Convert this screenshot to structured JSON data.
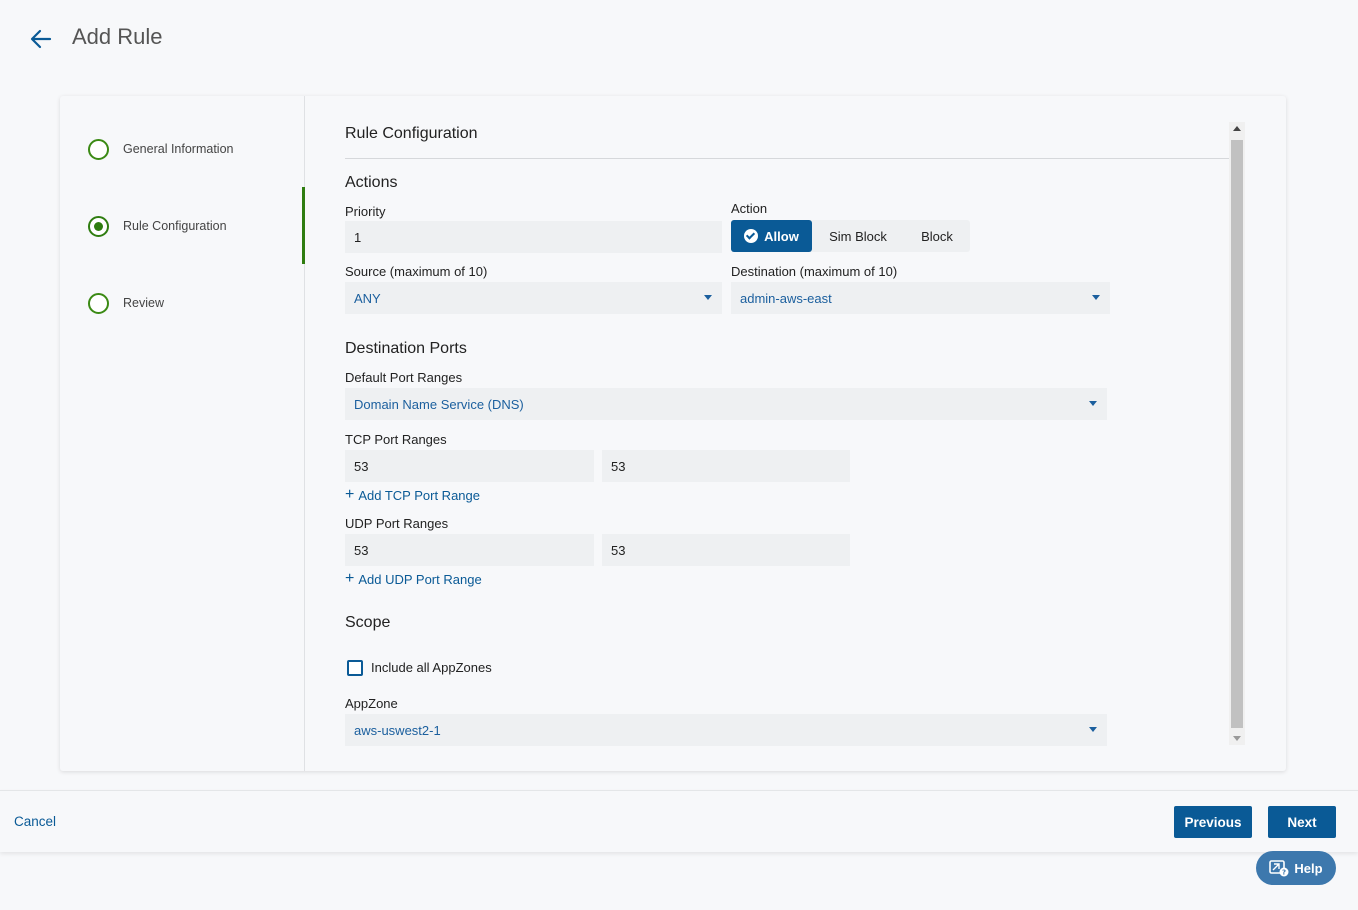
{
  "header": {
    "title": "Add Rule"
  },
  "steps": [
    {
      "label": "General Information",
      "state": "done"
    },
    {
      "label": "Rule Configuration",
      "state": "active"
    },
    {
      "label": "Review",
      "state": "pending"
    }
  ],
  "form": {
    "section_title": "Rule Configuration",
    "actions": {
      "title": "Actions",
      "priority_label": "Priority",
      "priority_value": "1",
      "action_label": "Action",
      "action_options": [
        "Allow",
        "Sim Block",
        "Block"
      ],
      "action_selected": "Allow",
      "source_label": "Source (maximum of 10)",
      "source_value": "ANY",
      "destination_label": "Destination (maximum of 10)",
      "destination_value": "admin-aws-east"
    },
    "ports": {
      "title": "Destination Ports",
      "default_label": "Default Port Ranges",
      "default_value": "Domain Name Service (DNS)",
      "tcp_label": "TCP Port Ranges",
      "tcp_from": "53",
      "tcp_to": "53",
      "add_tcp": "Add TCP Port Range",
      "udp_label": "UDP Port Ranges",
      "udp_from": "53",
      "udp_to": "53",
      "add_udp": "Add UDP Port Range"
    },
    "scope": {
      "title": "Scope",
      "include_all_label": "Include all AppZones",
      "include_all_checked": false,
      "appzone_label": "AppZone",
      "appzone_value": "aws-uswest2-1"
    }
  },
  "footer": {
    "cancel": "Cancel",
    "previous": "Previous",
    "next": "Next"
  },
  "help": {
    "label": "Help"
  },
  "colors": {
    "primary": "#0a5a96",
    "step_green": "#2f7d10",
    "field_bg": "#eef0f2"
  }
}
